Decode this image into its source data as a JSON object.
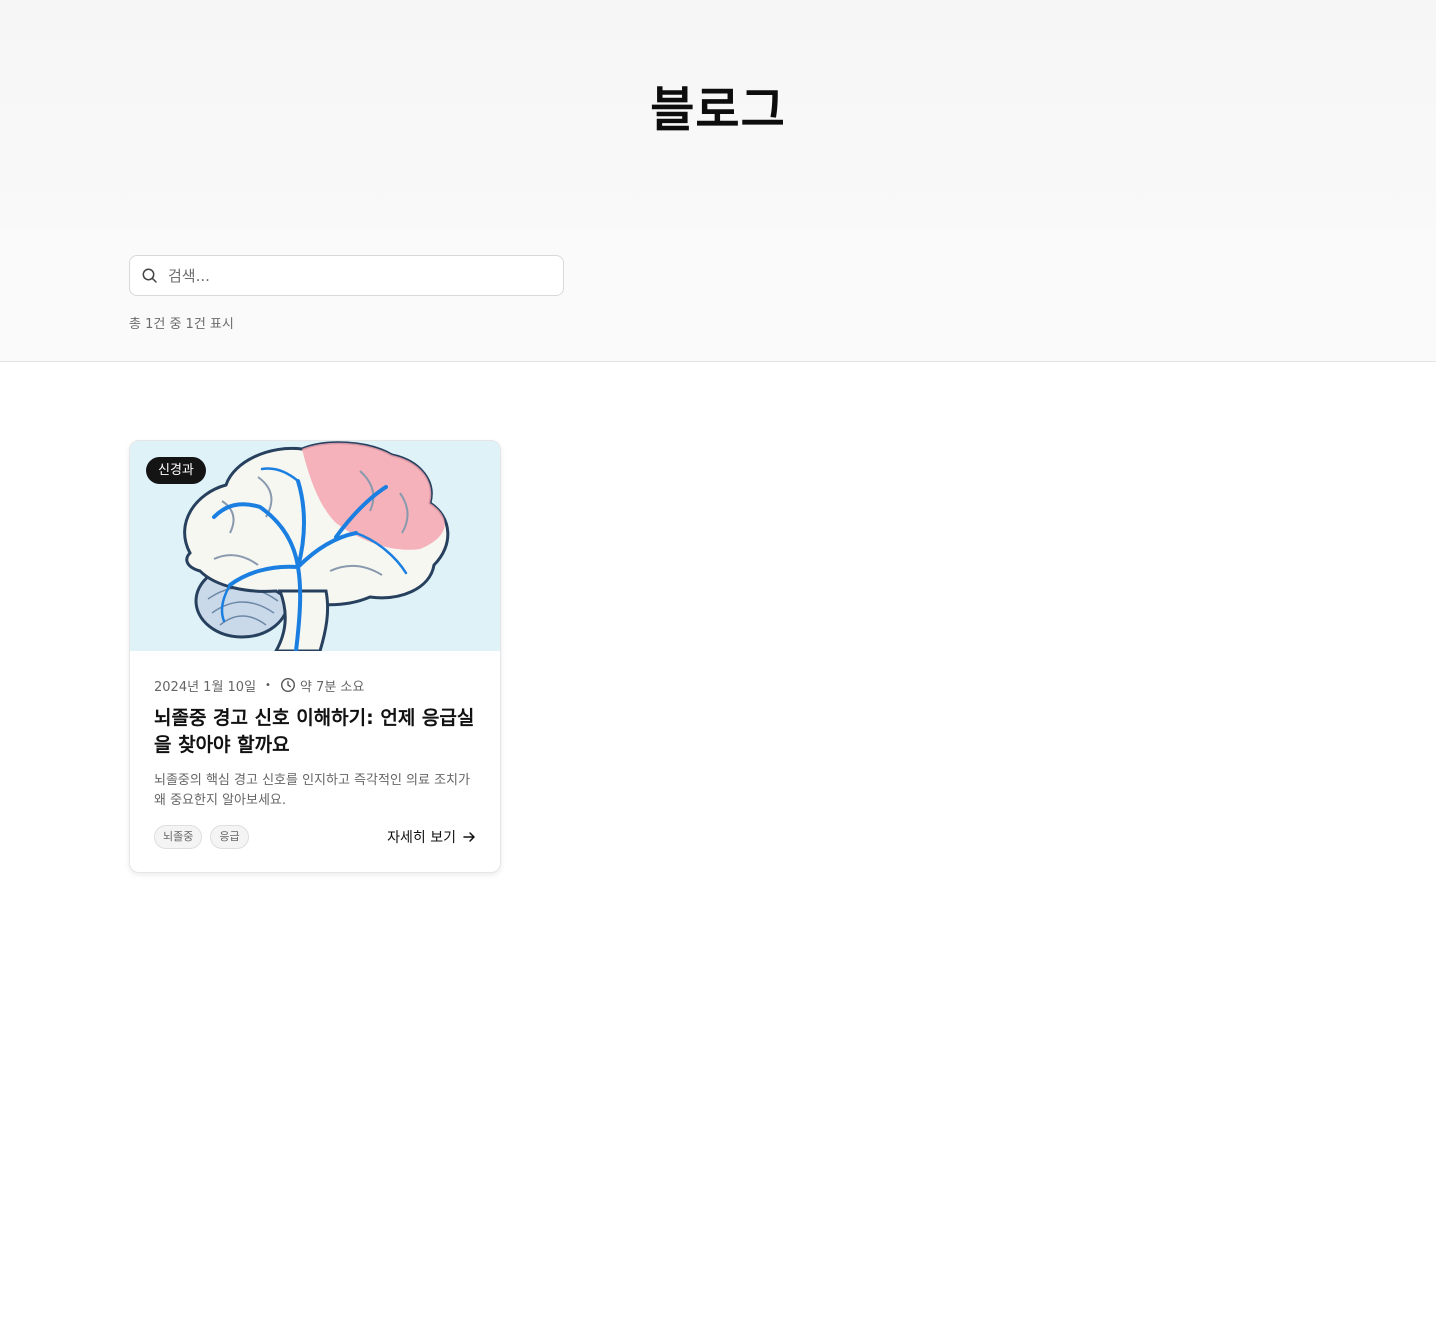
{
  "header": {
    "title": "블로그"
  },
  "search": {
    "placeholder": "검색...",
    "value": ""
  },
  "results": {
    "summary": "총 1건 중 1건 표시"
  },
  "posts": [
    {
      "category": "신경과",
      "date": "2024년 1월 10일",
      "read_time": "약 7분 소요",
      "title": "뇌졸중 경고 신호 이해하기: 언제 응급실을 찾아야 할까요",
      "description": "뇌졸중의 핵심 경고 신호를 인지하고 즉각적인 의료 조치가 왜 중요한지 알아보세요.",
      "tags": [
        "뇌졸중",
        "응급"
      ],
      "read_more_label": "자세히 보기",
      "image_icon": "brain-illustration"
    }
  ],
  "colors": {
    "hero_bg": "#f6f6f6",
    "badge_bg": "#141414",
    "image_bg": "#def2f8",
    "vessel_blue": "#1a7fe0",
    "brain_pink": "#f5a6b0"
  }
}
